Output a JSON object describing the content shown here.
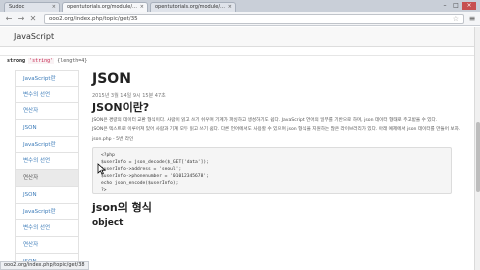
{
  "browser": {
    "tabs": [
      {
        "label": "Sudoc",
        "active": false
      },
      {
        "label": "opentutorials.org/module/…",
        "active": true
      },
      {
        "label": "opentutorials.org/module/…",
        "active": false
      }
    ],
    "url": "ooo2.org/index.php/topic/get/35",
    "status_url": "ooo2.org/index.php/topic/get/38"
  },
  "site": {
    "brand": "JavaScript",
    "breadcrumb_prefix": "strong",
    "breadcrumb_code": "'string'",
    "breadcrumb_suffix": "{length=4}"
  },
  "sidebar": {
    "items": [
      {
        "label": "JavaScript란"
      },
      {
        "label": "변수의 선언"
      },
      {
        "label": "연산자"
      },
      {
        "label": "JSON"
      },
      {
        "label": "JavaScript란"
      },
      {
        "label": "변수의 선언"
      },
      {
        "label": "연산자",
        "active": true
      },
      {
        "label": "JSON"
      },
      {
        "label": "JavaScript란"
      },
      {
        "label": "변수의 선언"
      },
      {
        "label": "연산자"
      },
      {
        "label": "JSON"
      }
    ]
  },
  "article": {
    "title": "JSON",
    "date": "2015년 3월 14일 9시 15분 47초",
    "heading": "JSON이란?",
    "paragraph1": "JSON은 경량의 데이터 교환 형식이다. 사람이 읽고 쓰기 쉬우며 기계가 파싱하고 생성하기도 쉽다. JavaScript 언어의 일부를 기반으로 하며, json 데이터 형태로 주고받을 수 있다.",
    "paragraph2": "JSON은 텍스트로 이루어져 있어 사람과 기계 모두 읽고 쓰기 쉽다. 다른 언어에서도 사용할 수 있으며 json 형식을 지원하는 많은 라이브러리가 있다. 아래 예제에서 json 데이터를 만들어 보자.",
    "code_caption": "json.php - 5번 라인",
    "code_lines": [
      "<?php",
      "$userInfo = json_decode($_GET['data']);",
      "$userInfo->address = 'seoul';",
      "$userInfo->phonenumber = '01012345678';",
      "echo json_encode($userInfo);",
      "?>"
    ],
    "heading2": "json의 형식",
    "heading3": "object"
  }
}
